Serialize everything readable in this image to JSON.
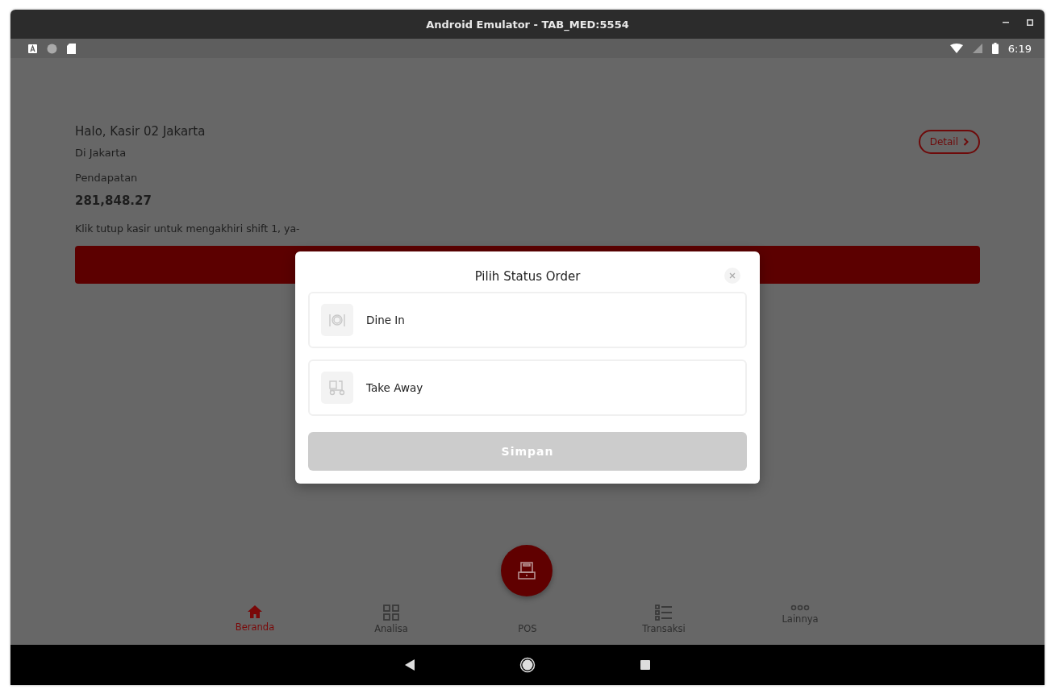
{
  "window": {
    "title": "Android Emulator - TAB_MED:5554"
  },
  "status_bar": {
    "time": "6:19"
  },
  "home": {
    "greeting": "Halo, Kasir 02 Jakarta",
    "location": "Di Jakarta",
    "detail_button": "Detail",
    "revenue_label": "Pendapatan",
    "revenue": "281,848.27",
    "shift_note": "Klik tutup kasir untuk mengakhiri shift 1, ya-"
  },
  "modal": {
    "title": "Pilih Status Order",
    "options": [
      {
        "kind": "dine_in",
        "label": "Dine In",
        "selected": false
      },
      {
        "kind": "take_away",
        "label": "Take Away",
        "selected": false
      }
    ],
    "save_button": {
      "label": "Simpan",
      "disabled": true
    }
  },
  "bottom_nav": {
    "items": [
      {
        "kind": "home",
        "label": "Beranda",
        "selected": true
      },
      {
        "kind": "grid",
        "label": "Analisa",
        "selected": false
      },
      {
        "kind": "pos",
        "label": "POS",
        "selected": false
      },
      {
        "kind": "list",
        "label": "Transaksi",
        "selected": false
      },
      {
        "kind": "more",
        "label": "Lainnya",
        "selected": false
      }
    ]
  }
}
